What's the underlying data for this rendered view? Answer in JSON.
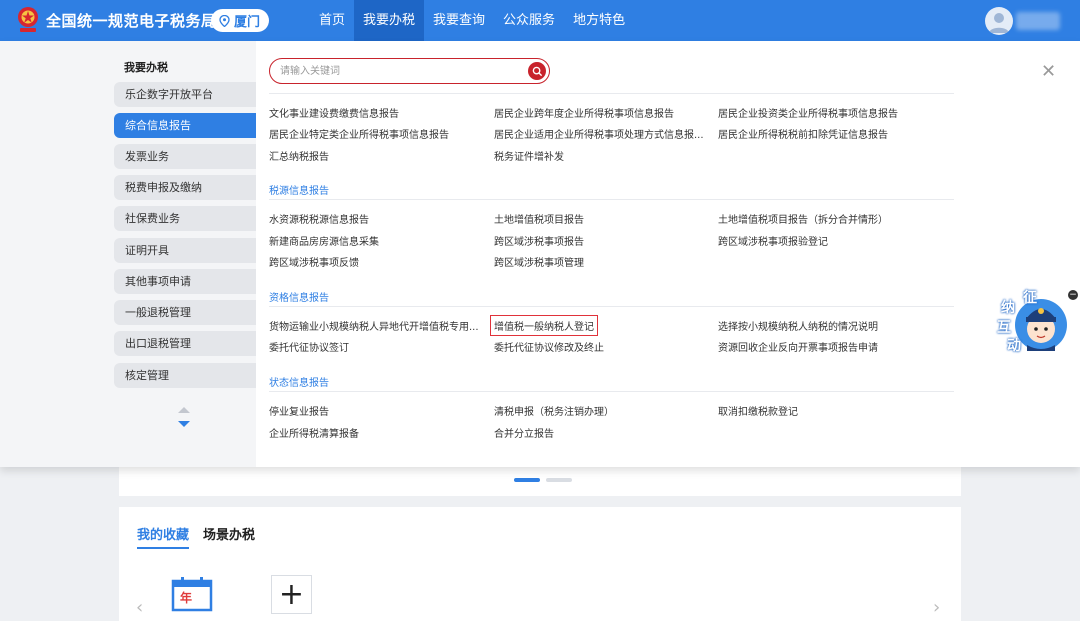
{
  "header": {
    "site_title": "全国统一规范电子税务局",
    "city": "厦门",
    "nav": [
      "首页",
      "我要办税",
      "我要查询",
      "公众服务",
      "地方特色"
    ]
  },
  "panel": {
    "sidebar_title": "我要办税",
    "sidebar_items": [
      "乐企数字开放平台",
      "综合信息报告",
      "发票业务",
      "税费申报及缴纳",
      "社保费业务",
      "证明开具",
      "其他事项申请",
      "一般退税管理",
      "出口退税管理",
      "核定管理"
    ],
    "search_placeholder": "请输入关键词",
    "top_links": [
      [
        "文化事业建设费缴费信息报告",
        "居民企业跨年度企业所得税事项信息报告",
        "居民企业投资类企业所得税事项信息报告"
      ],
      [
        "居民企业特定类企业所得税事项信息报告",
        "居民企业适用企业所得税事项处理方式信息报...",
        "居民企业所得税税前扣除凭证信息报告"
      ],
      [
        "汇总纳税报告",
        "税务证件增补发",
        ""
      ]
    ],
    "sections": [
      {
        "title": "税源信息报告",
        "links": [
          [
            "水资源税税源信息报告",
            "土地增值税项目报告",
            "土地增值税项目报告（拆分合并情形）"
          ],
          [
            "新建商品房房源信息采集",
            "跨区域涉税事项报告",
            "跨区域涉税事项报验登记"
          ],
          [
            "跨区域涉税事项反馈",
            "跨区域涉税事项管理",
            ""
          ]
        ]
      },
      {
        "title": "资格信息报告",
        "links": [
          [
            "货物运输业小规模纳税人异地代开增值税专用...",
            "增值税一般纳税人登记",
            "选择按小规模纳税人纳税的情况说明"
          ],
          [
            "委托代征协议签订",
            "委托代征协议修改及终止",
            "资源回收企业反向开票事项报告申请"
          ]
        ]
      },
      {
        "title": "状态信息报告",
        "links": [
          [
            "停业复业报告",
            "清税申报（税务注销办理）",
            "取消扣缴税款登记"
          ],
          [
            "企业所得税清算报备",
            "合并分立报告",
            ""
          ]
        ]
      }
    ]
  },
  "favorites": {
    "tabs": [
      "我的收藏",
      "场景办税"
    ],
    "calendar_label": "年",
    "add_symbol": "+"
  },
  "mascot": {
    "chars": [
      "征",
      "纳",
      "互",
      "动"
    ]
  },
  "colors": {
    "brand_blue": "#2f7fe3",
    "nav_active": "#1e66c6",
    "highlight_red": "#e0323a",
    "search_red": "#c8232c"
  }
}
